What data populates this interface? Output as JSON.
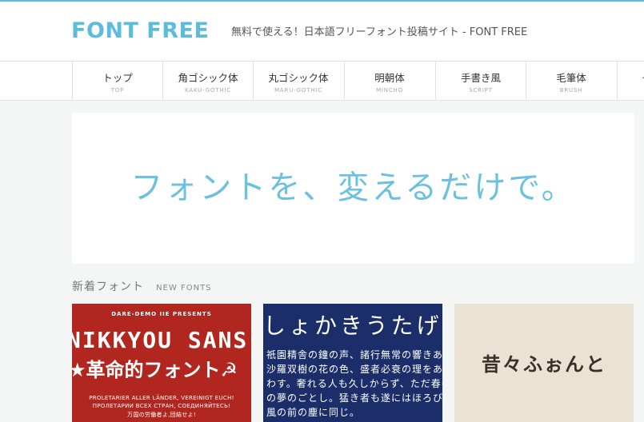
{
  "header": {
    "logo": "FONT FREE",
    "tagline": "無料で使える！日本語フリーフォント投稿サイト - FONT FREE"
  },
  "nav": {
    "items": [
      {
        "jp": "トップ",
        "en": "TOP"
      },
      {
        "jp": "角ゴシック体",
        "en": "KAKU-GOTHIC"
      },
      {
        "jp": "丸ゴシック体",
        "en": "MARU-GOTHIC"
      },
      {
        "jp": "明朝体",
        "en": "MINCHO"
      },
      {
        "jp": "手書き風",
        "en": "SCRIPT"
      },
      {
        "jp": "毛筆体",
        "en": "BRUSH"
      },
      {
        "jp": "その他",
        "en": ""
      }
    ]
  },
  "hero": {
    "text": "フォントを、変えるだけで。"
  },
  "new_fonts": {
    "title_jp": "新着フォント",
    "title_en": "NEW FONTS",
    "cards": [
      {
        "presents": "DARE-DEMO IIE PRESENTS",
        "name": "NIKKYOU SANS",
        "subtitle": "★革命的フォント☭",
        "line1": "PROLETARIER ALLER LÄNDER, VEREINIGT EUCH!",
        "line2": "ПРОЛЕТАРИИ ВСЕХ СТРАН, СОЕДИНЯЙТЕСЬ!",
        "line3": "万国の労働者よ,団結せよ!"
      },
      {
        "title": "しょかきうたげ",
        "line1": "祇園精舎の鐘の声、諸行無常の響きあり",
        "line2": "沙羅双樹の花の色、盛者必衰の理をあら",
        "line3": "わす。奢れる人も久しからず、ただ春の夜",
        "line4": "の夢のごとし。猛き者も遂にはほろびぬ、偏に",
        "line5": "風の前の塵に同じ。"
      },
      {
        "title": "昔々ふぉんと"
      }
    ]
  }
}
